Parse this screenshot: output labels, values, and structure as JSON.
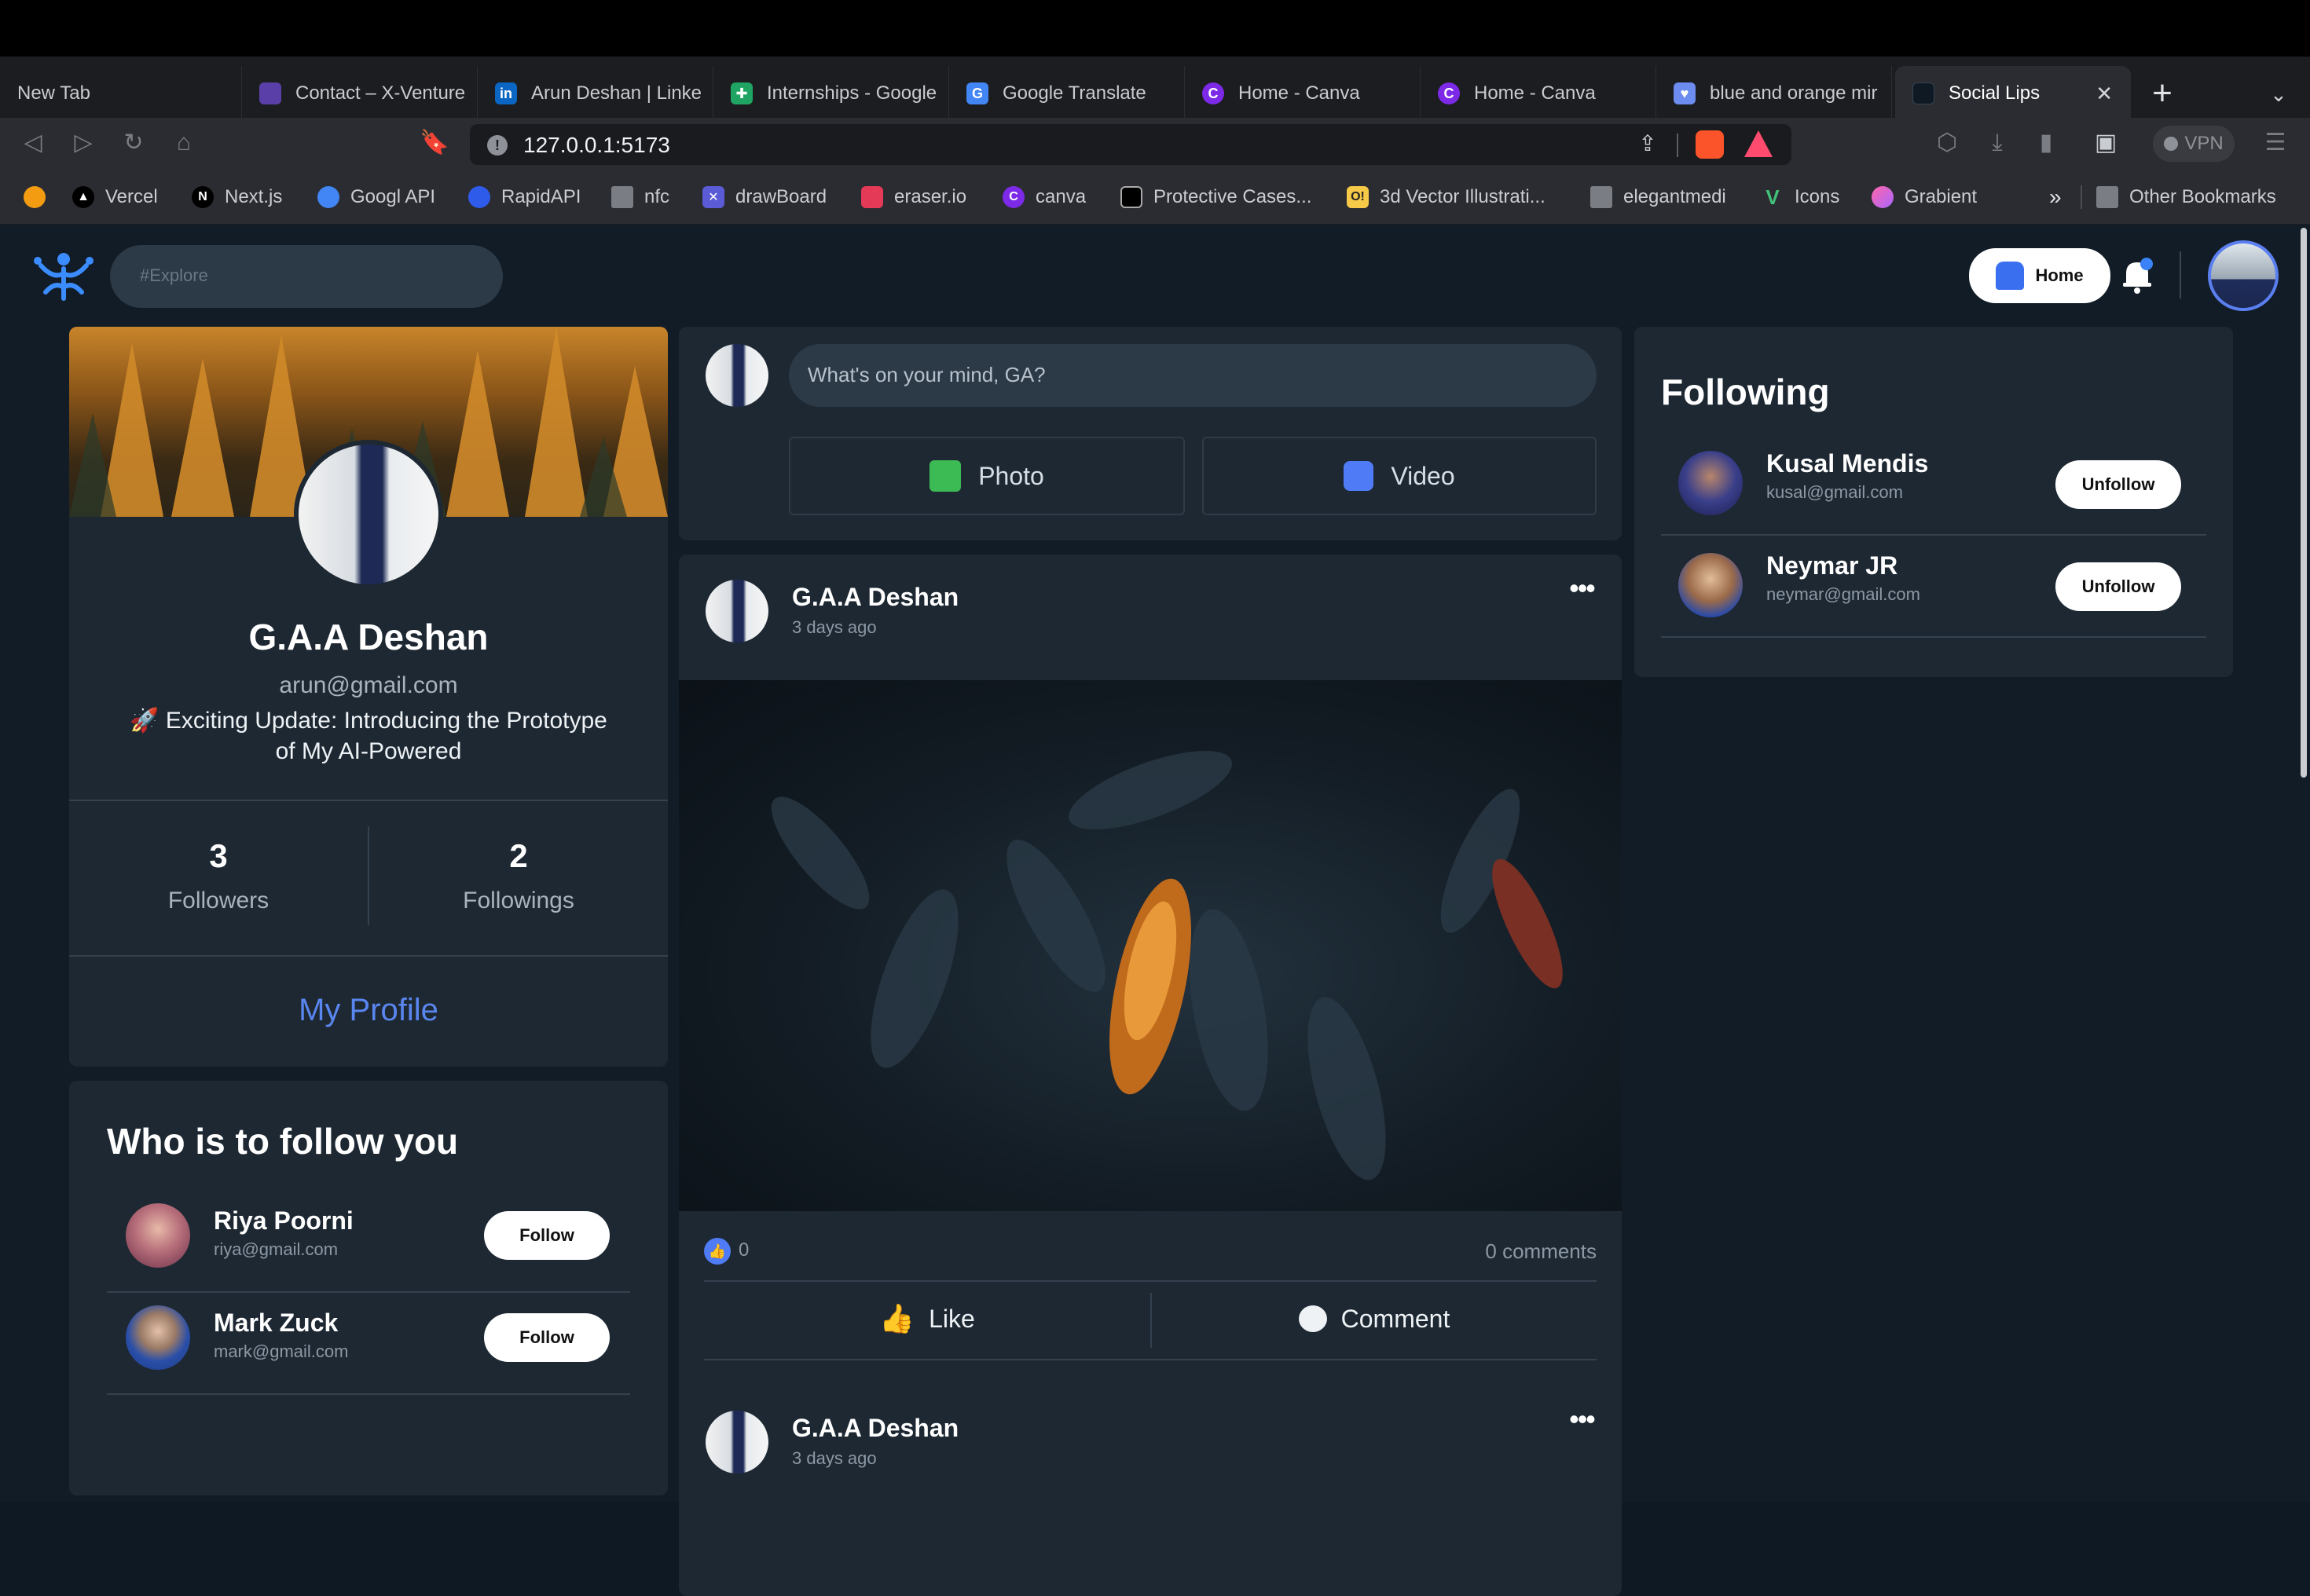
{
  "browser": {
    "tabs": [
      {
        "label": "New Tab"
      },
      {
        "label": "Contact – X-Venture"
      },
      {
        "label": "Arun Deshan | Linke"
      },
      {
        "label": "Internships - Google"
      },
      {
        "label": "Google Translate"
      },
      {
        "label": "Home - Canva"
      },
      {
        "label": "Home - Canva"
      },
      {
        "label": "blue and orange mir"
      },
      {
        "label": "Social Lips"
      }
    ],
    "url": "127.0.0.1:5173",
    "vpn_label": "VPN",
    "bookmarks": [
      {
        "label": "Vercel"
      },
      {
        "label": "Next.js"
      },
      {
        "label": "Googl API"
      },
      {
        "label": "RapidAPI"
      },
      {
        "label": "nfc"
      },
      {
        "label": "drawBoard"
      },
      {
        "label": "eraser.io"
      },
      {
        "label": "canva"
      },
      {
        "label": "Protective Cases..."
      },
      {
        "label": "3d Vector Illustrati..."
      },
      {
        "label": "elegantmedi"
      },
      {
        "label": "Icons"
      },
      {
        "label": "Grabient"
      }
    ],
    "more_bookmarks": "»",
    "other_bookmarks": "Other Bookmarks",
    "favicon_glyphs": {
      "linkedin": "in",
      "nextjs": "N",
      "canva": "C",
      "olapic": "O!"
    }
  },
  "header": {
    "search_placeholder": "#Explore",
    "home_label": "Home"
  },
  "profile": {
    "name": "G.A.A Deshan",
    "email": "arun@gmail.com",
    "bio_line1": "🚀 Exciting Update: Introducing the Prototype",
    "bio_line2": "of My AI-Powered",
    "followers_count": "3",
    "followers_label": "Followers",
    "followings_count": "2",
    "followings_label": "Followings",
    "my_profile_label": "My Profile"
  },
  "suggestions": {
    "title": "Who is to follow you",
    "users": [
      {
        "name": "Riya Poorni",
        "email": "riya@gmail.com",
        "action": "Follow"
      },
      {
        "name": "Mark Zuck",
        "email": "mark@gmail.com",
        "action": "Follow"
      }
    ]
  },
  "composer": {
    "placeholder": "What's on your mind, GA?",
    "photo_label": "Photo",
    "video_label": "Video"
  },
  "posts": [
    {
      "author": "G.A.A Deshan",
      "time": "3 days ago",
      "likes": "0",
      "comments": "0 comments",
      "like_label": "Like",
      "comment_label": "Comment"
    },
    {
      "author": "G.A.A Deshan",
      "time": "3 days ago"
    }
  ],
  "following": {
    "title": "Following",
    "users": [
      {
        "name": "Kusal Mendis",
        "email": "kusal@gmail.com",
        "action": "Unfollow"
      },
      {
        "name": "Neymar JR",
        "email": "neymar@gmail.com",
        "action": "Unfollow"
      }
    ]
  },
  "colors": {
    "accent_blue": "#4f7cf6",
    "background": "#111c26",
    "card": "#1d2833"
  }
}
